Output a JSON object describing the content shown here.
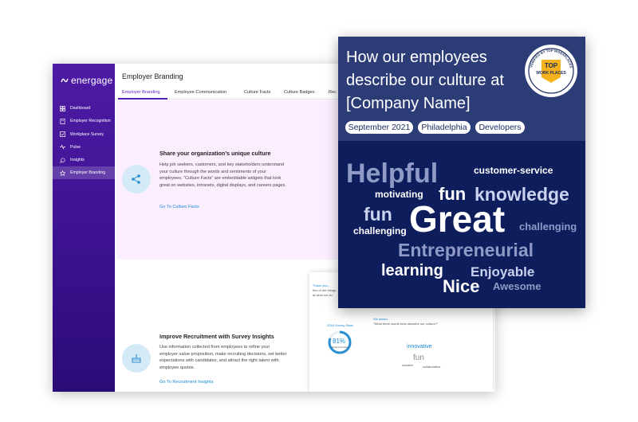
{
  "back_window": {
    "logo": "energage",
    "sidebar": {
      "items": [
        {
          "label": "Dashboard",
          "icon": "dashboard-icon"
        },
        {
          "label": "Employer Recognition",
          "icon": "award-icon"
        },
        {
          "label": "Workplace Survey",
          "icon": "checkbox-icon"
        },
        {
          "label": "Pulse",
          "icon": "pulse-icon"
        },
        {
          "label": "Insights",
          "icon": "insights-icon"
        },
        {
          "label": "Employer Branding",
          "icon": "star-icon",
          "active": true
        }
      ]
    },
    "page_title": "Employer Branding",
    "tabs": [
      "Employer Branding",
      "Employee Communication",
      "Culture Facts",
      "Culture Badges",
      "Rec"
    ],
    "section1": {
      "heading": "Share your organization’s unique culture",
      "body": "Help job seekers, customers, and key stakeholders understand your culture through the words and sentiments of your employees. “Culture Facts” are embeddable widgets that look great on websites, intranets, digital displays, and careers pages.",
      "link": "Go To Culture Facts"
    },
    "section2": {
      "heading": "Improve Recruitment with Survey Insights",
      "body": "Use information collected from employees to refine your employer value proposition, make recruiting decisions, set better expectations with candidates, and attract the right talent with employee quotes.",
      "link": "Go To Recruitment Insights"
    },
    "embedded_screenshot": {
      "thank_line1": "Thank you...",
      "thank_line2": "few of the things...",
      "thank_line3": "at what we do",
      "stats_title": "2018 Survey Stats",
      "ring_value": "81%",
      "ring_label": "Response Rate",
      "question_small": "We asked",
      "question": "\"What three words best describe our culture?\"",
      "words": [
        "innovative",
        "fun",
        "creative",
        "collaborative"
      ]
    }
  },
  "card": {
    "title": "How our employees describe our culture at [Company Name]",
    "pills": [
      "September 2021",
      "Philadelphia",
      "Developers"
    ],
    "badge": {
      "top_text": "VERIFIED BY TOP WORKPLACES",
      "center_top": "TOP",
      "center_bottom": "WORK PLACES"
    },
    "cloud": [
      {
        "text": "Helpful",
        "color": "#8f9ac6"
      },
      {
        "text": "customer-service",
        "color": "#ffffff"
      },
      {
        "text": "motivating",
        "color": "#ffffff"
      },
      {
        "text": "fun",
        "color": "#ffffff"
      },
      {
        "text": "knowledge",
        "color": "#c9d2ef"
      },
      {
        "text": "fun",
        "color": "#c9d2ef"
      },
      {
        "text": "Great",
        "color": "#ffffff"
      },
      {
        "text": "challenging",
        "color": "#ffffff"
      },
      {
        "text": "challenging",
        "color": "#8f9ac6"
      },
      {
        "text": "Entrepreneurial",
        "color": "#8f9ac6"
      },
      {
        "text": "learning",
        "color": "#ffffff"
      },
      {
        "text": "Enjoyable",
        "color": "#c9d2ef"
      },
      {
        "text": "Nice",
        "color": "#ffffff"
      },
      {
        "text": "Awesome",
        "color": "#8f9ac6"
      }
    ]
  }
}
